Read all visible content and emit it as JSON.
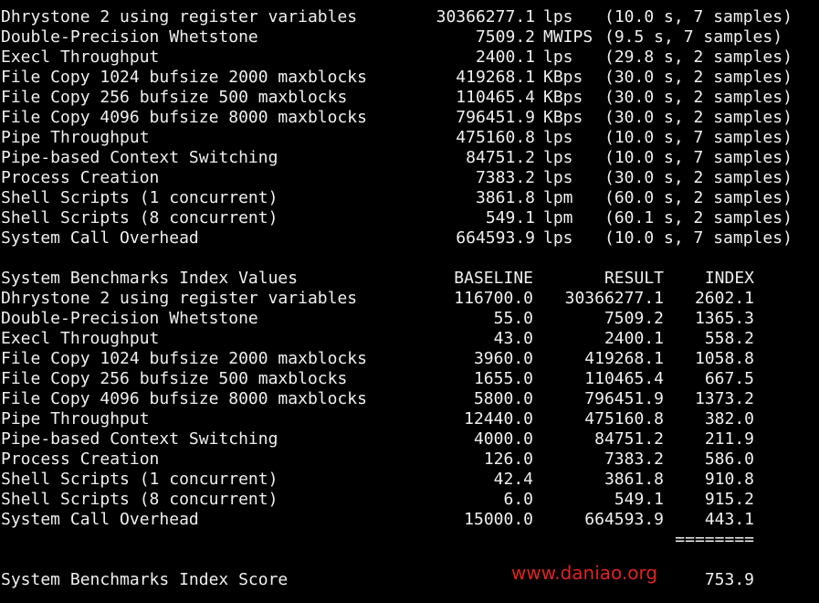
{
  "results": [
    {
      "name": "Dhrystone 2 using register variables",
      "value": "30366277.1",
      "unit": "lps",
      "detail": "(10.0 s, 7 samples)"
    },
    {
      "name": "Double-Precision Whetstone",
      "value": "7509.2",
      "unit": "MWIPS",
      "detail": "(9.5 s, 7 samples)"
    },
    {
      "name": "Execl Throughput",
      "value": "2400.1",
      "unit": "lps",
      "detail": "(29.8 s, 2 samples)"
    },
    {
      "name": "File Copy 1024 bufsize 2000 maxblocks",
      "value": "419268.1",
      "unit": "KBps",
      "detail": "(30.0 s, 2 samples)"
    },
    {
      "name": "File Copy 256 bufsize 500 maxblocks",
      "value": "110465.4",
      "unit": "KBps",
      "detail": "(30.0 s, 2 samples)"
    },
    {
      "name": "File Copy 4096 bufsize 8000 maxblocks",
      "value": "796451.9",
      "unit": "KBps",
      "detail": "(30.0 s, 2 samples)"
    },
    {
      "name": "Pipe Throughput",
      "value": "475160.8",
      "unit": "lps",
      "detail": "(10.0 s, 7 samples)"
    },
    {
      "name": "Pipe-based Context Switching",
      "value": "84751.2",
      "unit": "lps",
      "detail": "(10.0 s, 7 samples)"
    },
    {
      "name": "Process Creation",
      "value": "7383.2",
      "unit": "lps",
      "detail": "(30.0 s, 2 samples)"
    },
    {
      "name": "Shell Scripts (1 concurrent)",
      "value": "3861.8",
      "unit": "lpm",
      "detail": "(60.0 s, 2 samples)"
    },
    {
      "name": "Shell Scripts (8 concurrent)",
      "value": "549.1",
      "unit": "lpm",
      "detail": "(60.1 s, 2 samples)"
    },
    {
      "name": "System Call Overhead",
      "value": "664593.9",
      "unit": "lps",
      "detail": "(10.0 s, 7 samples)"
    }
  ],
  "index_table": {
    "header": {
      "title": "System Benchmarks Index Values",
      "baseline": "BASELINE",
      "result": "RESULT",
      "index": "INDEX"
    },
    "rows": [
      {
        "name": "Dhrystone 2 using register variables",
        "baseline": "116700.0",
        "result": "30366277.1",
        "index": "2602.1"
      },
      {
        "name": "Double-Precision Whetstone",
        "baseline": "55.0",
        "result": "7509.2",
        "index": "1365.3"
      },
      {
        "name": "Execl Throughput",
        "baseline": "43.0",
        "result": "2400.1",
        "index": "558.2"
      },
      {
        "name": "File Copy 1024 bufsize 2000 maxblocks",
        "baseline": "3960.0",
        "result": "419268.1",
        "index": "1058.8"
      },
      {
        "name": "File Copy 256 bufsize 500 maxblocks",
        "baseline": "1655.0",
        "result": "110465.4",
        "index": "667.5"
      },
      {
        "name": "File Copy 4096 bufsize 8000 maxblocks",
        "baseline": "5800.0",
        "result": "796451.9",
        "index": "1373.2"
      },
      {
        "name": "Pipe Throughput",
        "baseline": "12440.0",
        "result": "475160.8",
        "index": "382.0"
      },
      {
        "name": "Pipe-based Context Switching",
        "baseline": "4000.0",
        "result": "84751.2",
        "index": "211.9"
      },
      {
        "name": "Process Creation",
        "baseline": "126.0",
        "result": "7383.2",
        "index": "586.0"
      },
      {
        "name": "Shell Scripts (1 concurrent)",
        "baseline": "42.4",
        "result": "3861.8",
        "index": "910.8"
      },
      {
        "name": "Shell Scripts (8 concurrent)",
        "baseline": "6.0",
        "result": "549.1",
        "index": "915.2"
      },
      {
        "name": "System Call Overhead",
        "baseline": "15000.0",
        "result": "664593.9",
        "index": "443.1"
      }
    ],
    "separator": "========",
    "score_label": "System Benchmarks Index Score",
    "score_value": "753.9"
  },
  "watermark": "www.daniao.org",
  "colors": {
    "background": "#000000",
    "text": "#f0f0f0",
    "watermark": "#e02222"
  }
}
